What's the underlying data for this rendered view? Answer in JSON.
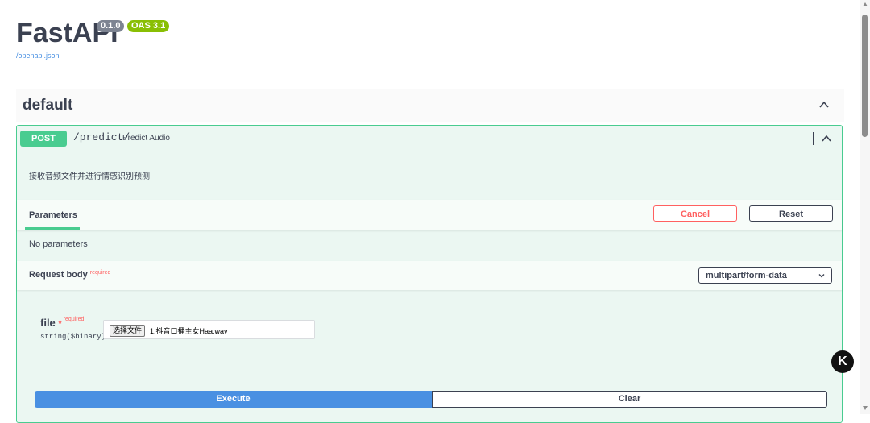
{
  "header": {
    "title": "FastAPI",
    "version": "0.1.0",
    "oas": "OAS 3.1",
    "spec_link": "/openapi.json"
  },
  "tag": {
    "name": "default"
  },
  "operation": {
    "method": "POST",
    "path": "/predict/",
    "summary": "Predict Audio",
    "description": "接收音频文件并进行情感识别预测"
  },
  "parameters": {
    "tab_label": "Parameters",
    "cancel_label": "Cancel",
    "reset_label": "Reset",
    "empty_text": "No parameters"
  },
  "request_body": {
    "label": "Request body",
    "required": "required",
    "content_type": "multipart/form-data"
  },
  "field": {
    "name": "file",
    "star": "*",
    "required": "required",
    "type": "string($binary)",
    "choose_label": "选择文件",
    "file_name": "1.抖音口播主女Haa.wav"
  },
  "actions": {
    "execute": "Execute",
    "clear": "Clear"
  },
  "colors": {
    "post": "#49cc90",
    "execute": "#4990e2",
    "cancel": "#ff6060"
  }
}
